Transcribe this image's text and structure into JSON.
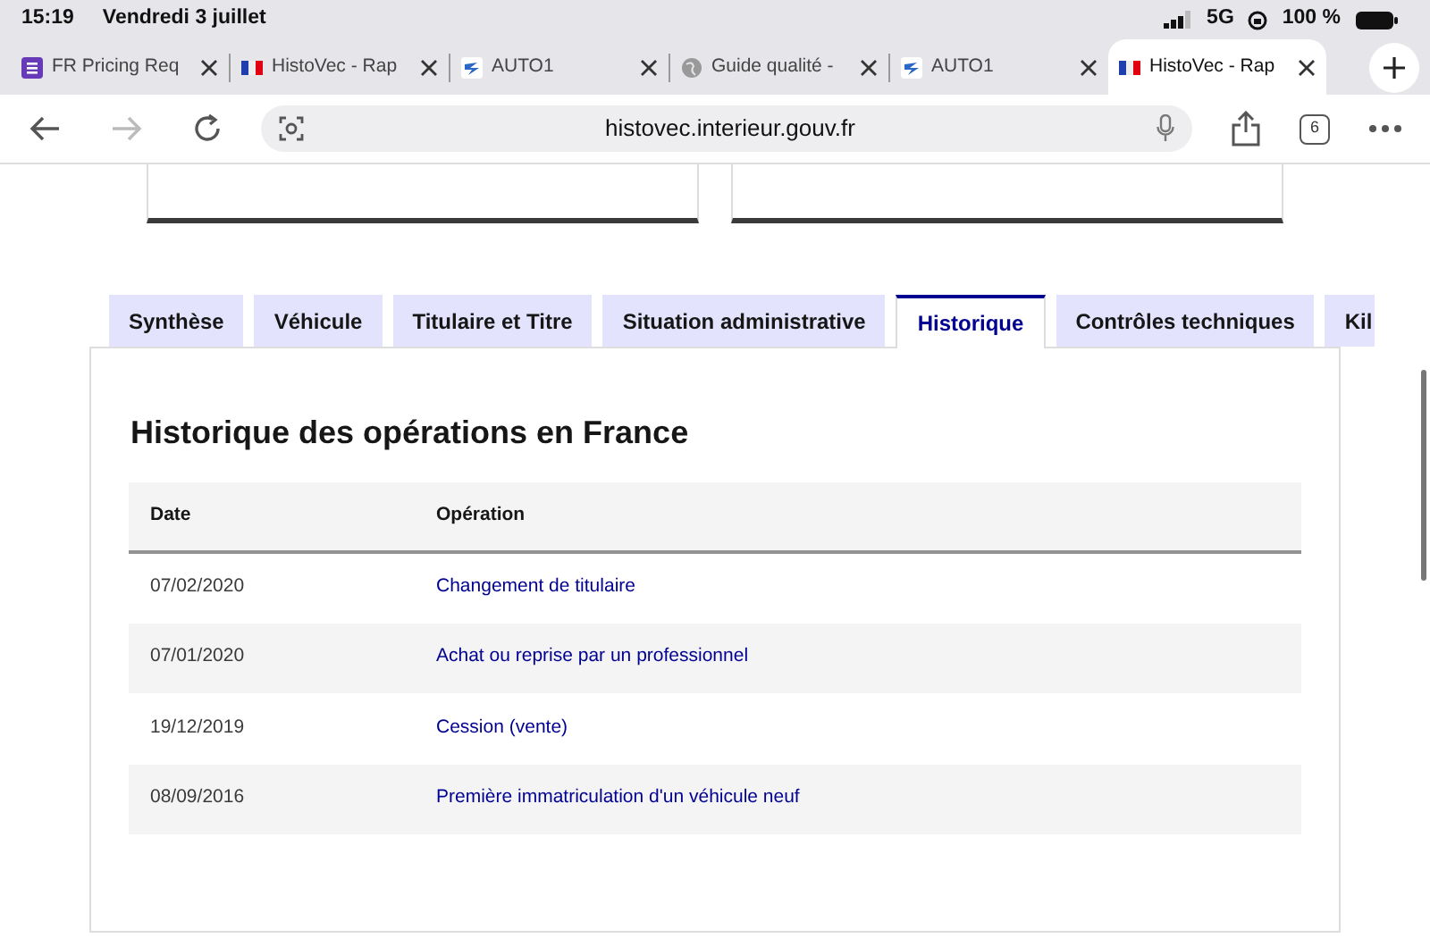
{
  "status_bar": {
    "time": "15:19",
    "date": "Vendredi 3 juillet",
    "network": "5G",
    "battery": "100 %"
  },
  "browser_tabs": [
    {
      "title": "FR Pricing Req",
      "kind": "form",
      "selected": false
    },
    {
      "title": "HistoVec - Rap",
      "kind": "flag",
      "selected": false
    },
    {
      "title": "AUTO1",
      "kind": "auto1",
      "selected": false
    },
    {
      "title": "Guide qualité -",
      "kind": "globe",
      "selected": false
    },
    {
      "title": "AUTO1",
      "kind": "auto1",
      "selected": false
    },
    {
      "title": "HistoVec - Rap",
      "kind": "flag",
      "selected": true
    }
  ],
  "toolbar": {
    "back_disabled": false,
    "forward_disabled": true,
    "url": "histovec.interieur.gouv.fr",
    "tab_count": "6"
  },
  "page_tabs": [
    {
      "label": "Synthèse",
      "selected": false
    },
    {
      "label": "Véhicule",
      "selected": false
    },
    {
      "label": "Titulaire et Titre",
      "selected": false
    },
    {
      "label": "Situation administrative",
      "selected": false
    },
    {
      "label": "Historique",
      "selected": true
    },
    {
      "label": "Contrôles techniques",
      "selected": false
    },
    {
      "label": "Kil",
      "selected": false
    }
  ],
  "section": {
    "title": "Historique des opérations en France",
    "table": {
      "columns": [
        "Date",
        "Opération"
      ],
      "rows": [
        {
          "date": "07/02/2020",
          "operation": "Changement de titulaire"
        },
        {
          "date": "07/01/2020",
          "operation": "Achat ou reprise par un professionnel"
        },
        {
          "date": "19/12/2019",
          "operation": "Cession (vente)"
        },
        {
          "date": "08/09/2016",
          "operation": "Première immatriculation d'un véhicule neuf"
        }
      ]
    }
  }
}
